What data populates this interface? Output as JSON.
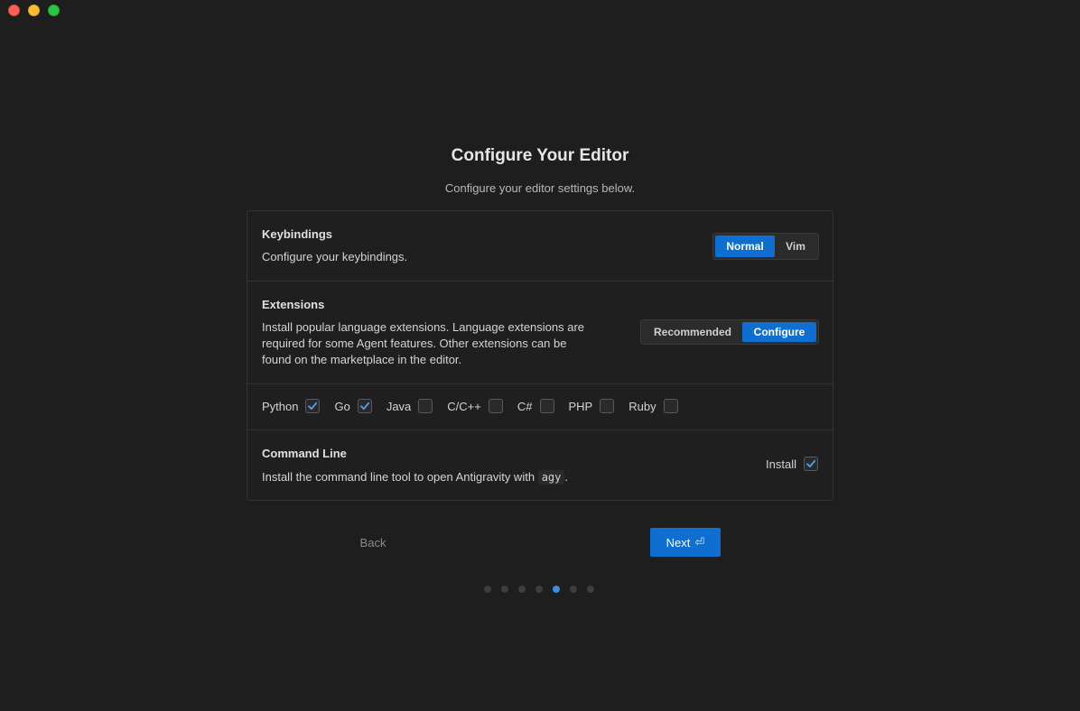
{
  "page": {
    "title": "Configure Your Editor",
    "subtitle": "Configure your editor settings below."
  },
  "keybindings": {
    "title": "Keybindings",
    "description": "Configure your keybindings.",
    "options": [
      "Normal",
      "Vim"
    ],
    "selected": "Normal"
  },
  "extensions": {
    "title": "Extensions",
    "description": "Install popular language extensions. Language extensions are required for some Agent features. Other extensions can be found on the marketplace in the editor.",
    "options": [
      "Recommended",
      "Configure"
    ],
    "selected": "Configure",
    "languages": [
      {
        "label": "Python",
        "checked": true
      },
      {
        "label": "Go",
        "checked": true
      },
      {
        "label": "Java",
        "checked": false
      },
      {
        "label": "C/C++",
        "checked": false
      },
      {
        "label": "C#",
        "checked": false
      },
      {
        "label": "PHP",
        "checked": false
      },
      {
        "label": "Ruby",
        "checked": false
      }
    ]
  },
  "command_line": {
    "title": "Command Line",
    "description_prefix": "Install the command line tool to open Antigravity with",
    "command": "agy",
    "description_suffix": ".",
    "install_label": "Install",
    "install_checked": true
  },
  "nav": {
    "back_label": "Back",
    "next_label": "Next",
    "next_icon": "return-icon",
    "total_steps": 7,
    "current_step": 5
  },
  "colors": {
    "accent": "#0e6fd0",
    "background": "#1e1e1e"
  }
}
